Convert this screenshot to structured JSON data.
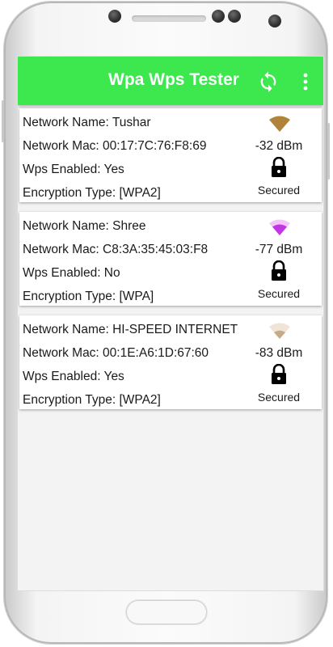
{
  "app": {
    "title": "Wpa Wps Tester",
    "accent_color": "#3de84f",
    "actions": [
      "refresh-icon",
      "more-vert-icon"
    ]
  },
  "networks": [
    {
      "name_line": "Network Name: Tushar",
      "mac_line": "Network Mac: 00:17:7C:76:F8:69",
      "wps_line": "Wps Enabled: Yes",
      "enc_line": "Encryption Type: [WPA2]",
      "signal": "-32 dBm",
      "signal_icon": "wifi-signal-icon",
      "signal_color": "#b0823a",
      "status": "Secured",
      "status_icon": "lock-icon"
    },
    {
      "name_line": "Network Name: Shree",
      "mac_line": "Network Mac: C8:3A:35:45:03:F8",
      "wps_line": "Wps Enabled: No",
      "enc_line": "Encryption Type: [WPA]",
      "signal": "-77 dBm",
      "signal_icon": "wifi-signal-icon",
      "signal_color": "#c236e6",
      "status": "Secured",
      "status_icon": "lock-icon"
    },
    {
      "name_line": "Network Name: HI-SPEED INTERNET",
      "mac_line": "Network Mac: 00:1E:A6:1D:67:60",
      "wps_line": "Wps Enabled: Yes",
      "enc_line": "Encryption Type: [WPA2]",
      "signal": "-83 dBm",
      "signal_icon": "wifi-signal-icon",
      "signal_color": "#c7ab88",
      "status": "Secured",
      "status_icon": "lock-icon"
    }
  ]
}
